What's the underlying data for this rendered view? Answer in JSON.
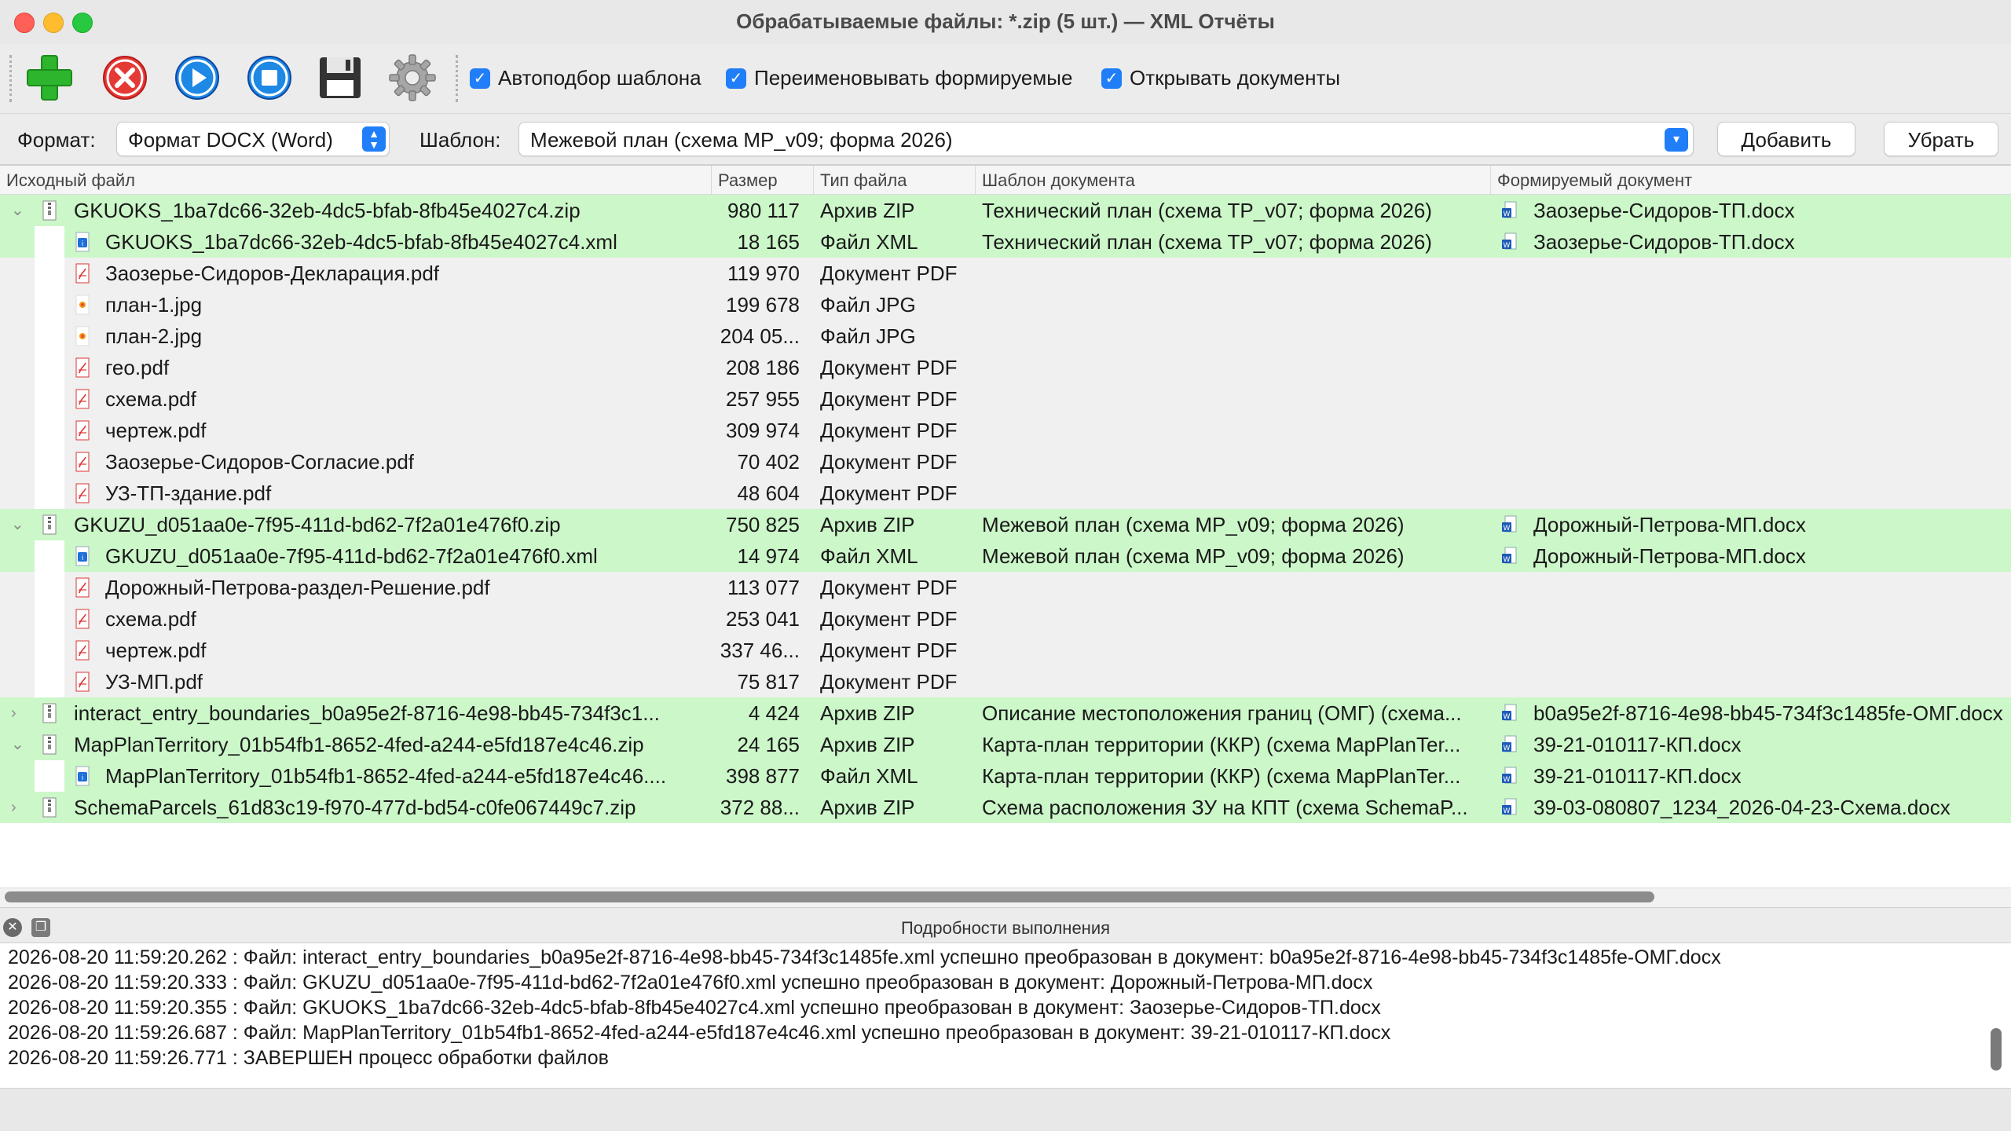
{
  "window": {
    "title": "Обрабатываемые файлы: *.zip (5 шт.) — XML Отчёты"
  },
  "toolbar": {
    "buttons": [
      {
        "icon": "add-icon",
        "color": "#2db52d"
      },
      {
        "icon": "delete-icon",
        "color": "#e53935"
      },
      {
        "icon": "play-icon",
        "color": "#1e88e5"
      },
      {
        "icon": "stop-icon",
        "color": "#1e88e5"
      },
      {
        "icon": "save-icon",
        "color": "#333333"
      },
      {
        "icon": "settings-icon",
        "color": "#9e9e9e"
      }
    ],
    "checkbox_autoselect": "Автоподбор шаблона",
    "checkbox_rename": "Переименовывать формируемые",
    "checkbox_open": "Открывать документы"
  },
  "format": {
    "label": "Формат:",
    "value": "Формат DOCX (Word)",
    "template_label": "Шаблон:",
    "template_value": "Межевой план (схема MP_v09; форма 2026)",
    "add_button": "Добавить",
    "remove_button": "Убрать"
  },
  "table": {
    "columns": [
      "Исходный файл",
      "Размер",
      "Тип файла",
      "Шаблон документа",
      "Формируемый документ"
    ],
    "rows": [
      {
        "level": 0,
        "expander": "down",
        "icon": "zip",
        "name": "GKUOKS_1ba7dc66-32eb-4dc5-bfab-8fb45e4027c4.zip",
        "size": "980 117",
        "type": "Архив ZIP",
        "template": "Технический план (схема TP_v07; форма 2026)",
        "output": "Заозерье-Сидоров-ТП.docx",
        "ok": true
      },
      {
        "level": 1,
        "icon": "xml",
        "name": "GKUOKS_1ba7dc66-32eb-4dc5-bfab-8fb45e4027c4.xml",
        "size": "18 165",
        "type": "Файл XML",
        "template": "Технический план (схема TP_v07; форма 2026)",
        "output": "Заозерье-Сидоров-ТП.docx",
        "ok": true
      },
      {
        "level": 1,
        "icon": "pdf",
        "name": "Заозерье-Сидоров-Декларация.pdf",
        "size": "119 970",
        "type": "Документ PDF",
        "template": "",
        "output": "",
        "ok": false
      },
      {
        "level": 1,
        "icon": "jpg",
        "name": "план-1.jpg",
        "size": "199 678",
        "type": "Файл JPG",
        "template": "",
        "output": "",
        "ok": false
      },
      {
        "level": 1,
        "icon": "jpg",
        "name": "план-2.jpg",
        "size": "204 05...",
        "type": "Файл JPG",
        "template": "",
        "output": "",
        "ok": false
      },
      {
        "level": 1,
        "icon": "pdf",
        "name": "гео.pdf",
        "size": "208 186",
        "type": "Документ PDF",
        "template": "",
        "output": "",
        "ok": false
      },
      {
        "level": 1,
        "icon": "pdf",
        "name": "схема.pdf",
        "size": "257 955",
        "type": "Документ PDF",
        "template": "",
        "output": "",
        "ok": false
      },
      {
        "level": 1,
        "icon": "pdf",
        "name": "чертеж.pdf",
        "size": "309 974",
        "type": "Документ PDF",
        "template": "",
        "output": "",
        "ok": false
      },
      {
        "level": 1,
        "icon": "pdf",
        "name": "Заозерье-Сидоров-Согласие.pdf",
        "size": "70 402",
        "type": "Документ PDF",
        "template": "",
        "output": "",
        "ok": false
      },
      {
        "level": 1,
        "icon": "pdf",
        "name": "УЗ-ТП-здание.pdf",
        "size": "48 604",
        "type": "Документ PDF",
        "template": "",
        "output": "",
        "ok": false
      },
      {
        "level": 0,
        "expander": "down",
        "icon": "zip",
        "name": "GKUZU_d051aa0e-7f95-411d-bd62-7f2a01e476f0.zip",
        "size": "750 825",
        "type": "Архив ZIP",
        "template": "Межевой план (схема MP_v09; форма 2026)",
        "output": "Дорожный-Петрова-МП.docx",
        "ok": true
      },
      {
        "level": 1,
        "icon": "xml",
        "name": "GKUZU_d051aa0e-7f95-411d-bd62-7f2a01e476f0.xml",
        "size": "14 974",
        "type": "Файл XML",
        "template": "Межевой план (схема MP_v09; форма 2026)",
        "output": "Дорожный-Петрова-МП.docx",
        "ok": true
      },
      {
        "level": 1,
        "icon": "pdf",
        "name": "Дорожный-Петрова-раздел-Решение.pdf",
        "size": "113 077",
        "type": "Документ PDF",
        "template": "",
        "output": "",
        "ok": false
      },
      {
        "level": 1,
        "icon": "pdf",
        "name": "схема.pdf",
        "size": "253 041",
        "type": "Документ PDF",
        "template": "",
        "output": "",
        "ok": false
      },
      {
        "level": 1,
        "icon": "pdf",
        "name": "чертеж.pdf",
        "size": "337 46...",
        "type": "Документ PDF",
        "template": "",
        "output": "",
        "ok": false
      },
      {
        "level": 1,
        "icon": "pdf",
        "name": "УЗ-МП.pdf",
        "size": "75 817",
        "type": "Документ PDF",
        "template": "",
        "output": "",
        "ok": false
      },
      {
        "level": 0,
        "expander": "right",
        "icon": "zip",
        "name": "interact_entry_boundaries_b0a95e2f-8716-4e98-bb45-734f3c1...",
        "size": "4 424",
        "type": "Архив ZIP",
        "template": "Описание местоположения границ (ОМГ) (схема...",
        "output": "b0a95e2f-8716-4e98-bb45-734f3c1485fe-ОМГ.docx",
        "ok": true
      },
      {
        "level": 0,
        "expander": "down",
        "icon": "zip",
        "name": "MapPlanTerritory_01b54fb1-8652-4fed-a244-e5fd187e4c46.zip",
        "size": "24 165",
        "type": "Архив ZIP",
        "template": "Карта-план территории (ККР) (схема MapPlanTer...",
        "output": "39-21-010117-КП.docx",
        "ok": true
      },
      {
        "level": 1,
        "icon": "xml",
        "name": "MapPlanTerritory_01b54fb1-8652-4fed-a244-e5fd187e4c46....",
        "size": "398 877",
        "type": "Файл XML",
        "template": "Карта-план территории (ККР) (схема MapPlanTer...",
        "output": "39-21-010117-КП.docx",
        "ok": true
      },
      {
        "level": 0,
        "expander": "right",
        "icon": "zip",
        "name": "SchemaParcels_61d83c19-f970-477d-bd54-c0fe067449c7.zip",
        "size": "372 88...",
        "type": "Архив ZIP",
        "template": "Схема расположения ЗУ на КПТ (схема SchemaP...",
        "output": "39-03-080807_1234_2026-04-23-Схема.docx",
        "ok": true
      }
    ]
  },
  "log": {
    "title": "Подробности выполнения",
    "lines": [
      "2026-08-20 11:59:20.262 : Файл: interact_entry_boundaries_b0a95e2f-8716-4e98-bb45-734f3c1485fe.xml успешно преобразован в документ: b0a95e2f-8716-4e98-bb45-734f3c1485fe-ОМГ.docx",
      "2026-08-20 11:59:20.333 : Файл: GKUZU_d051aa0e-7f95-411d-bd62-7f2a01e476f0.xml успешно преобразован в документ: Дорожный-Петрова-МП.docx",
      "2026-08-20 11:59:20.355 : Файл: GKUOKS_1ba7dc66-32eb-4dc5-bfab-8fb45e4027c4.xml успешно преобразован в документ: Заозерье-Сидоров-ТП.docx",
      "2026-08-20 11:59:26.687 : Файл: MapPlanTerritory_01b54fb1-8652-4fed-a244-e5fd187e4c46.xml успешно преобразован в документ: 39-21-010117-КП.docx",
      "2026-08-20 11:59:26.771 : ЗАВЕРШЕН процесс обработки файлов"
    ]
  },
  "colors": {
    "success_row": "#ccf7c9",
    "accent": "#1f7ef8"
  }
}
